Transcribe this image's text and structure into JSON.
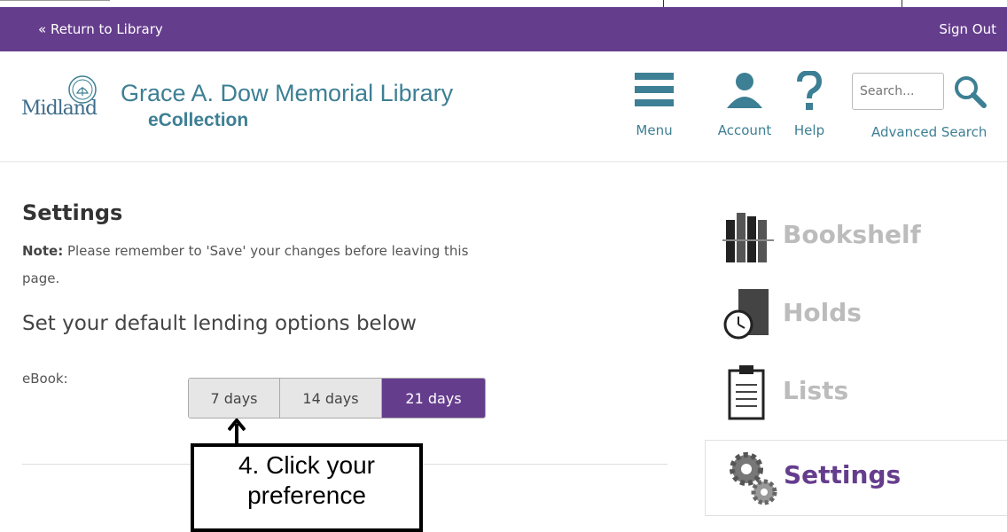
{
  "topbar": {
    "return_label": "« Return to Library",
    "signout_label": "Sign Out",
    "bg_color": "#653d8d"
  },
  "header": {
    "logo_city": "Midland",
    "logo_title": "Grace A. Dow Memorial Library",
    "logo_subtitle": "eCollection",
    "nav": {
      "menu_label": "Menu",
      "account_label": "Account",
      "help_label": "Help"
    },
    "search": {
      "placeholder": "Search...",
      "advanced_label": "Advanced Search"
    }
  },
  "main": {
    "title": "Settings",
    "note_bold": "Note:",
    "note_text": " Please remember to 'Save' your changes before leaving this page.",
    "lending_heading": "Set your default lending options below",
    "ebook_label": "eBook:",
    "lending_options": [
      {
        "label": "7 days",
        "selected": false
      },
      {
        "label": "14 days",
        "selected": false
      },
      {
        "label": "21 days",
        "selected": true
      }
    ]
  },
  "callout": {
    "line1": "4. Click your",
    "line2": "preference"
  },
  "sidebar": {
    "items": [
      {
        "label": "Bookshelf",
        "icon": "bookshelf-icon",
        "active": false
      },
      {
        "label": "Holds",
        "icon": "holds-icon",
        "active": false
      },
      {
        "label": "Lists",
        "icon": "lists-icon",
        "active": false
      },
      {
        "label": "Settings",
        "icon": "gears-icon",
        "active": true
      }
    ]
  },
  "colors": {
    "accent": "#653d8d",
    "teal": "#3d7f94",
    "inactive_sidebar": "#bcbcbc"
  }
}
